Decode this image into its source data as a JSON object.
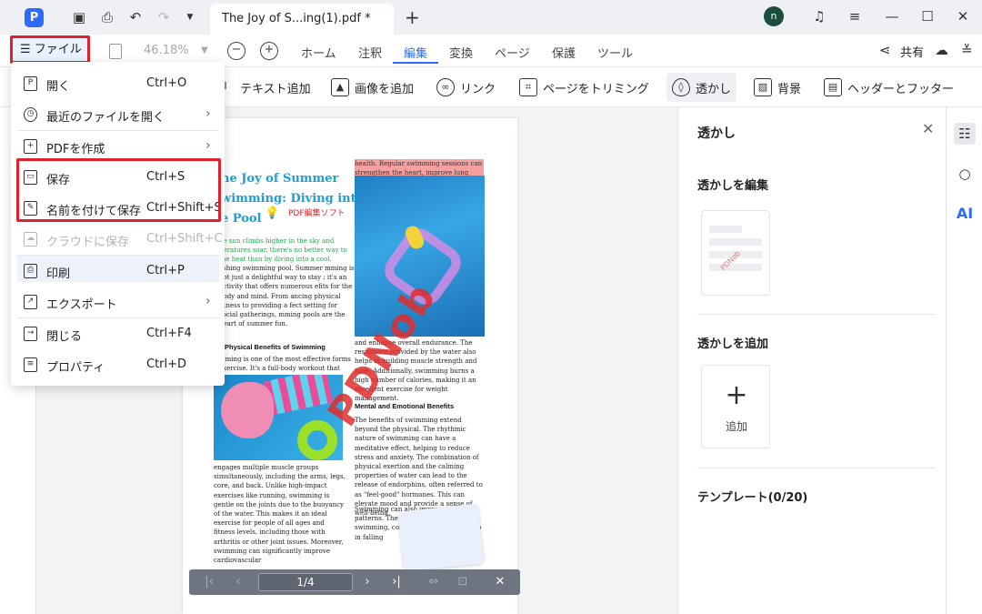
{
  "titlebar": {
    "document_tab": "The Joy of S...ing(1).pdf *",
    "avatar_initial": "n"
  },
  "menubar": {
    "file_label": "☰ ファイル",
    "zoom": "46.18%",
    "tabs": [
      "ホーム",
      "注釈",
      "編集",
      "変換",
      "ページ",
      "保護",
      "ツール"
    ],
    "active_tab": "編集",
    "share_label": "共有"
  },
  "toolbar": {
    "items": [
      "テキスト追加",
      "画像を追加",
      "リンク",
      "ページをトリミング",
      "透かし",
      "背景",
      "ヘッダーとフッター"
    ]
  },
  "file_menu": {
    "items": [
      {
        "label": "開く",
        "shortcut": "Ctrl+O"
      },
      {
        "label": "最近のファイルを開く",
        "shortcut": ""
      },
      {
        "label": "PDFを作成",
        "shortcut": ""
      },
      {
        "label": "保存",
        "shortcut": "Ctrl+S"
      },
      {
        "label": "名前を付けて保存",
        "shortcut": "Ctrl+Shift+S"
      },
      {
        "label": "クラウドに保存",
        "shortcut": "Ctrl+Shift+C"
      },
      {
        "label": "印刷",
        "shortcut": "Ctrl+P"
      },
      {
        "label": "エクスポート",
        "shortcut": ""
      },
      {
        "label": "閉じる",
        "shortcut": "Ctrl+F4"
      },
      {
        "label": "プロパティ",
        "shortcut": "Ctrl+D"
      }
    ]
  },
  "document": {
    "title": "he Joy of Summer wimming: Diving into e Pool",
    "signature": "PDF編集ソフト",
    "highlight": "health. Regular swimming sessions can strengthen the heart, improve lung capacity,",
    "intro_green": "he sun climbs higher in the sky and peratures soar, there's no better way to the heat than by diving into a cool,",
    "intro_rest": "eshing swimming pool. Summer mming is not just a delightful way to stay ; it's an activity that offers numerous efits for the body and mind. From ancing physical fitness to providing a fect setting for social gatherings, mming pools are the heart of summer fun.",
    "heading1": "Physical Benefits of Swimming",
    "para1": "mming is one of the most effective forms exercise. It's a full-body workout that",
    "para2": "engages multiple muscle groups simultaneously, including the arms, legs, core, and back. Unlike high-impact exercises like running, swimming is gentle on the joints due to the buoyancy of the water. This makes it an ideal exercise for people of all ages and fitness levels, including those with arthritis or other joint issues. Moreover, swimming can significantly improve cardiovascular",
    "col2_para1": "and enhance overall endurance. The resistance provided by the water also helps in building muscle strength and tone. Additionally, swimming burns a high number of calories, making it an excellent exercise for weight management.",
    "heading2": "Mental and Emotional Benefits",
    "col2_para2": "The benefits of swimming extend beyond the physical. The rhythmic nature of swimming can have a meditative effect, helping to reduce stress and anxiety. The combination of physical exertion and the calming properties of water can lead to the release of endorphins, often referred to as \"feel-good\" hormones. This can elevate mood and provide a sense of well-being.",
    "col2_para3": "Swimming can also improve sleep patterns. The physical exert d in swimming, combined with the can help in falling",
    "watermark_text": "PDNob"
  },
  "page_nav": {
    "page_indicator": "1/4"
  },
  "right_panel": {
    "title": "透かし",
    "edit_section": "透かしを編集",
    "add_section": "透かしを追加",
    "add_label": "追加",
    "template_section": "テンプレート(0/20)",
    "thumb_watermark": "PDNob"
  }
}
